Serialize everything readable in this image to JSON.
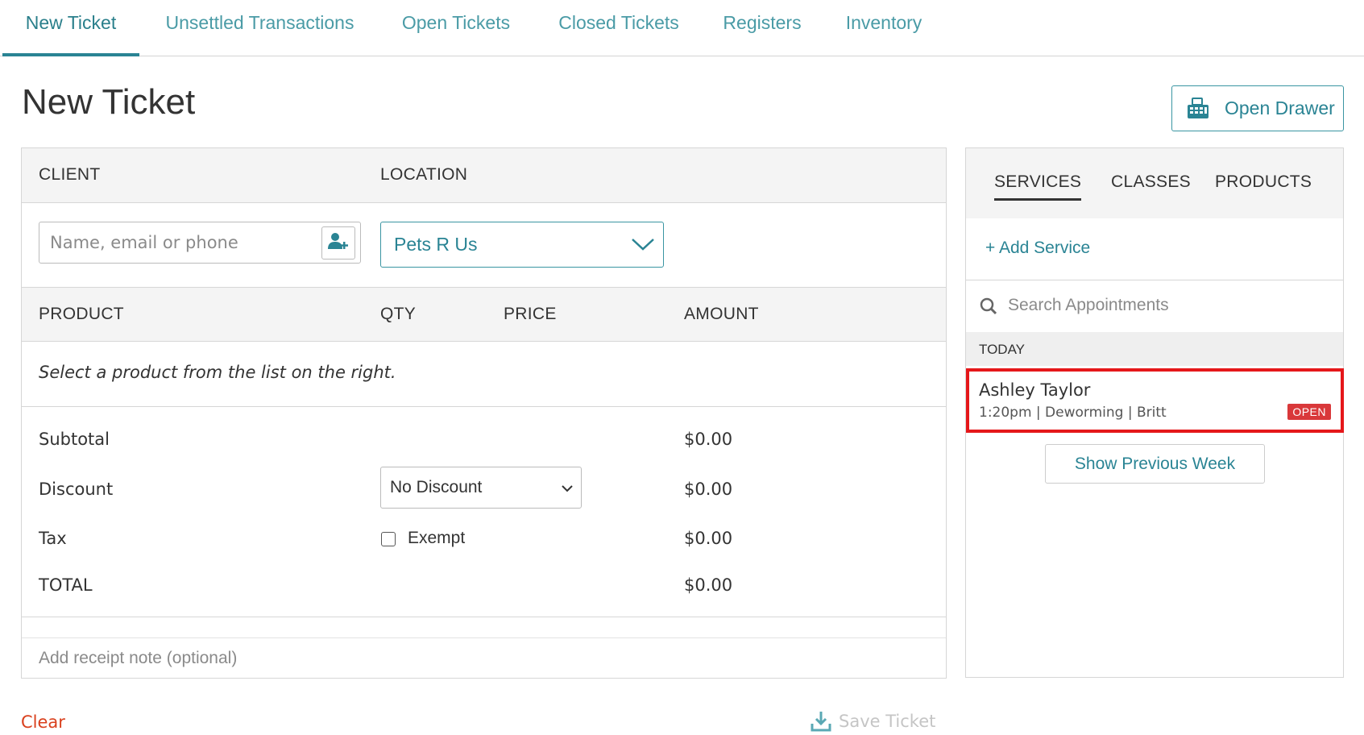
{
  "nav": {
    "tabs": [
      {
        "label": "New Ticket",
        "active": true
      },
      {
        "label": "Unsettled Transactions"
      },
      {
        "label": "Open Tickets"
      },
      {
        "label": "Closed Tickets"
      },
      {
        "label": "Registers"
      },
      {
        "label": "Inventory"
      }
    ]
  },
  "page": {
    "title": "New Ticket",
    "open_drawer_label": "Open Drawer"
  },
  "ticket": {
    "client_header": "CLIENT",
    "location_header": "LOCATION",
    "client_placeholder": "Name, email or phone",
    "location_value": "Pets R Us",
    "columns": [
      "PRODUCT",
      "QTY",
      "PRICE",
      "AMOUNT"
    ],
    "empty_message": "Select a product from the list on the right.",
    "summary": {
      "subtotal_label": "Subtotal",
      "subtotal_value": "$0.00",
      "discount_label": "Discount",
      "discount_select": "No Discount",
      "discount_value": "$0.00",
      "tax_label": "Tax",
      "exempt_label": "Exempt",
      "exempt_checked": false,
      "tax_value": "$0.00",
      "total_label": "TOTAL",
      "total_value": "$0.00"
    },
    "note_placeholder": "Add receipt note (optional)",
    "clear_label": "Clear",
    "save_label": "Save Ticket"
  },
  "sidebar": {
    "tabs": [
      {
        "label": "SERVICES",
        "active": true
      },
      {
        "label": "CLASSES"
      },
      {
        "label": "PRODUCTS"
      }
    ],
    "add_service_label": "+ Add Service",
    "search_placeholder": "Search Appointments",
    "section_label": "TODAY",
    "appointments": [
      {
        "name": "Ashley Taylor",
        "detail": "1:20pm | Deworming | Britt",
        "status": "OPEN"
      }
    ],
    "show_previous_label": "Show Previous Week"
  },
  "colors": {
    "accent": "#2a8494",
    "danger": "#d9401d",
    "highlight": "#e5171a"
  }
}
